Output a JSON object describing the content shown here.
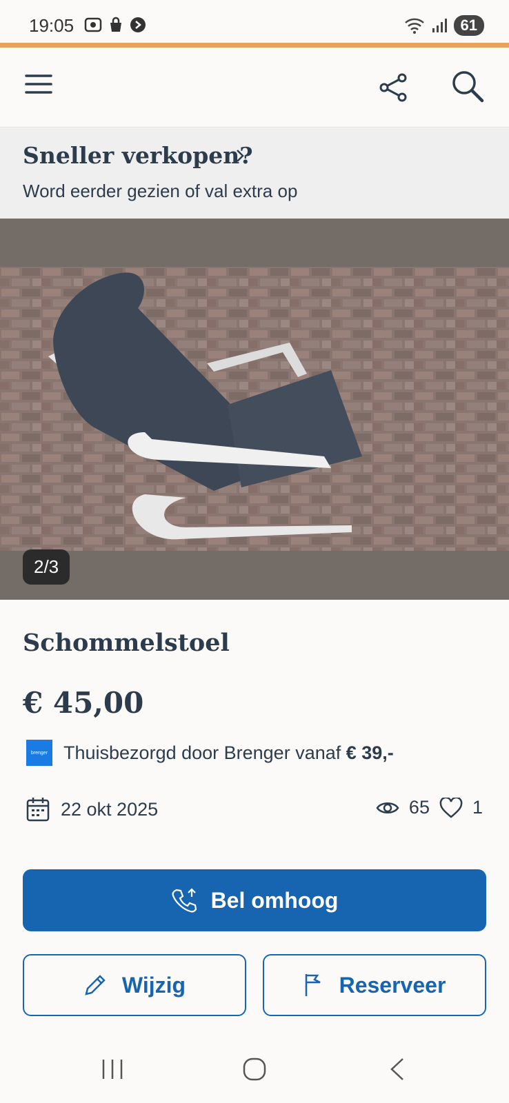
{
  "status_bar": {
    "time": "19:05",
    "battery": "61"
  },
  "header": {
    "menu_icon": "hamburger-menu-icon",
    "share_icon": "share-icon",
    "search_icon": "search-icon"
  },
  "promo": {
    "title": "Sneller verkopen?",
    "subtitle": "Word eerder gezien of val extra op"
  },
  "gallery": {
    "counter": "2/3"
  },
  "listing": {
    "title": "Schommelstoel",
    "price": "€ 45,00",
    "delivery_logo_text": "brenger",
    "delivery_text": "Thuisbezorgd door Brenger vanaf ",
    "delivery_price": "€ 39,-",
    "date": "22 okt 2025",
    "views": "65",
    "favorites": "1"
  },
  "actions": {
    "primary": "Bel omhoog",
    "edit": "Wijzig",
    "reserve": "Reserveer"
  },
  "colors": {
    "accent": "#e8a35c",
    "primary": "#1765b0",
    "text": "#2d3c4d"
  }
}
